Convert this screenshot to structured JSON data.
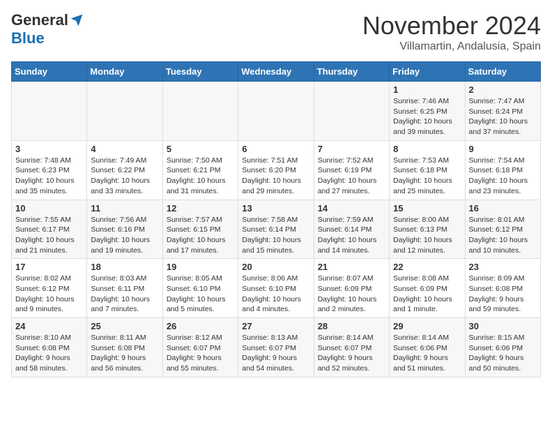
{
  "header": {
    "logo": {
      "general": "General",
      "blue": "Blue"
    },
    "title": "November 2024",
    "subtitle": "Villamartin, Andalusia, Spain"
  },
  "days_of_week": [
    "Sunday",
    "Monday",
    "Tuesday",
    "Wednesday",
    "Thursday",
    "Friday",
    "Saturday"
  ],
  "weeks": [
    [
      {
        "day": "",
        "info": ""
      },
      {
        "day": "",
        "info": ""
      },
      {
        "day": "",
        "info": ""
      },
      {
        "day": "",
        "info": ""
      },
      {
        "day": "",
        "info": ""
      },
      {
        "day": "1",
        "info": "Sunrise: 7:46 AM\nSunset: 6:25 PM\nDaylight: 10 hours and 39 minutes."
      },
      {
        "day": "2",
        "info": "Sunrise: 7:47 AM\nSunset: 6:24 PM\nDaylight: 10 hours and 37 minutes."
      }
    ],
    [
      {
        "day": "3",
        "info": "Sunrise: 7:48 AM\nSunset: 6:23 PM\nDaylight: 10 hours and 35 minutes."
      },
      {
        "day": "4",
        "info": "Sunrise: 7:49 AM\nSunset: 6:22 PM\nDaylight: 10 hours and 33 minutes."
      },
      {
        "day": "5",
        "info": "Sunrise: 7:50 AM\nSunset: 6:21 PM\nDaylight: 10 hours and 31 minutes."
      },
      {
        "day": "6",
        "info": "Sunrise: 7:51 AM\nSunset: 6:20 PM\nDaylight: 10 hours and 29 minutes."
      },
      {
        "day": "7",
        "info": "Sunrise: 7:52 AM\nSunset: 6:19 PM\nDaylight: 10 hours and 27 minutes."
      },
      {
        "day": "8",
        "info": "Sunrise: 7:53 AM\nSunset: 6:18 PM\nDaylight: 10 hours and 25 minutes."
      },
      {
        "day": "9",
        "info": "Sunrise: 7:54 AM\nSunset: 6:18 PM\nDaylight: 10 hours and 23 minutes."
      }
    ],
    [
      {
        "day": "10",
        "info": "Sunrise: 7:55 AM\nSunset: 6:17 PM\nDaylight: 10 hours and 21 minutes."
      },
      {
        "day": "11",
        "info": "Sunrise: 7:56 AM\nSunset: 6:16 PM\nDaylight: 10 hours and 19 minutes."
      },
      {
        "day": "12",
        "info": "Sunrise: 7:57 AM\nSunset: 6:15 PM\nDaylight: 10 hours and 17 minutes."
      },
      {
        "day": "13",
        "info": "Sunrise: 7:58 AM\nSunset: 6:14 PM\nDaylight: 10 hours and 15 minutes."
      },
      {
        "day": "14",
        "info": "Sunrise: 7:59 AM\nSunset: 6:14 PM\nDaylight: 10 hours and 14 minutes."
      },
      {
        "day": "15",
        "info": "Sunrise: 8:00 AM\nSunset: 6:13 PM\nDaylight: 10 hours and 12 minutes."
      },
      {
        "day": "16",
        "info": "Sunrise: 8:01 AM\nSunset: 6:12 PM\nDaylight: 10 hours and 10 minutes."
      }
    ],
    [
      {
        "day": "17",
        "info": "Sunrise: 8:02 AM\nSunset: 6:12 PM\nDaylight: 10 hours and 9 minutes."
      },
      {
        "day": "18",
        "info": "Sunrise: 8:03 AM\nSunset: 6:11 PM\nDaylight: 10 hours and 7 minutes."
      },
      {
        "day": "19",
        "info": "Sunrise: 8:05 AM\nSunset: 6:10 PM\nDaylight: 10 hours and 5 minutes."
      },
      {
        "day": "20",
        "info": "Sunrise: 8:06 AM\nSunset: 6:10 PM\nDaylight: 10 hours and 4 minutes."
      },
      {
        "day": "21",
        "info": "Sunrise: 8:07 AM\nSunset: 6:09 PM\nDaylight: 10 hours and 2 minutes."
      },
      {
        "day": "22",
        "info": "Sunrise: 8:08 AM\nSunset: 6:09 PM\nDaylight: 10 hours and 1 minute."
      },
      {
        "day": "23",
        "info": "Sunrise: 8:09 AM\nSunset: 6:08 PM\nDaylight: 9 hours and 59 minutes."
      }
    ],
    [
      {
        "day": "24",
        "info": "Sunrise: 8:10 AM\nSunset: 6:08 PM\nDaylight: 9 hours and 58 minutes."
      },
      {
        "day": "25",
        "info": "Sunrise: 8:11 AM\nSunset: 6:08 PM\nDaylight: 9 hours and 56 minutes."
      },
      {
        "day": "26",
        "info": "Sunrise: 8:12 AM\nSunset: 6:07 PM\nDaylight: 9 hours and 55 minutes."
      },
      {
        "day": "27",
        "info": "Sunrise: 8:13 AM\nSunset: 6:07 PM\nDaylight: 9 hours and 54 minutes."
      },
      {
        "day": "28",
        "info": "Sunrise: 8:14 AM\nSunset: 6:07 PM\nDaylight: 9 hours and 52 minutes."
      },
      {
        "day": "29",
        "info": "Sunrise: 8:14 AM\nSunset: 6:06 PM\nDaylight: 9 hours and 51 minutes."
      },
      {
        "day": "30",
        "info": "Sunrise: 8:15 AM\nSunset: 6:06 PM\nDaylight: 9 hours and 50 minutes."
      }
    ]
  ]
}
